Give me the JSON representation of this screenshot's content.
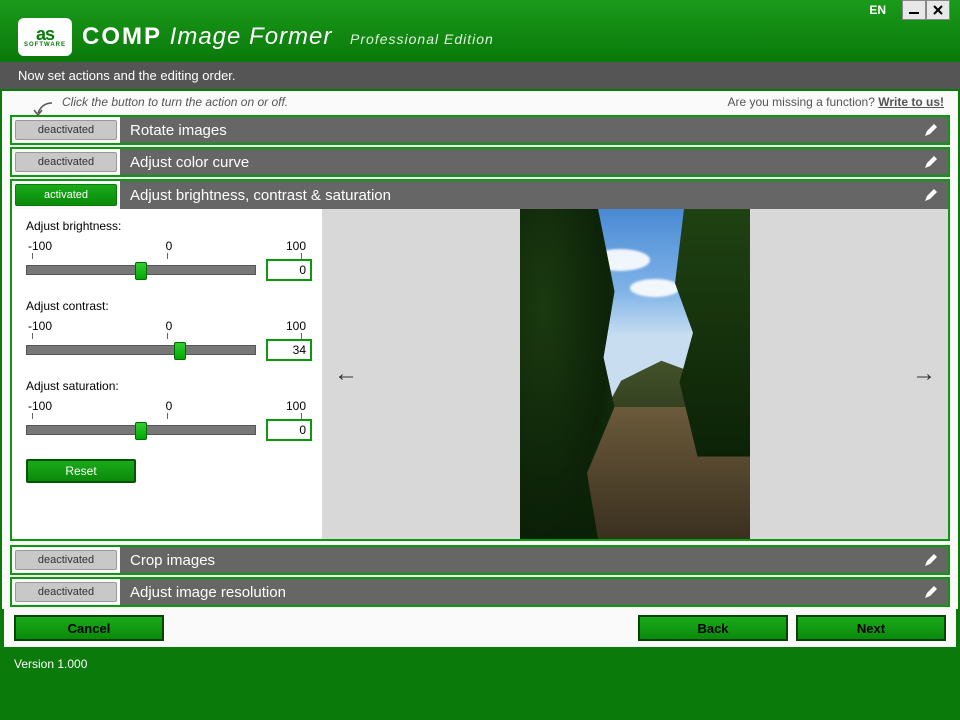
{
  "lang": "EN",
  "brand": {
    "badge_top": "as",
    "badge_bottom": "SOFTWARE",
    "comp": "COMP",
    "product": "Image Former",
    "edition": "Professional Edition"
  },
  "instruction": "Now set actions and the editing order.",
  "hint_left": "Click the button to turn the action on or off.",
  "hint_right_q": "Are you missing a function? ",
  "hint_right_link": "Write to us!",
  "toggle": {
    "off": "deactivated",
    "on": "activated"
  },
  "actions": {
    "rotate": "Rotate images",
    "colorcurve": "Adjust color curve",
    "bcs": "Adjust brightness, contrast & saturation",
    "crop": "Crop images",
    "resolution": "Adjust image resolution"
  },
  "sliders": {
    "brightness": {
      "label": "Adjust brightness:",
      "min": "-100",
      "mid": "0",
      "max": "100",
      "value": "0",
      "pct": 50
    },
    "contrast": {
      "label": "Adjust contrast:",
      "min": "-100",
      "mid": "0",
      "max": "100",
      "value": "34",
      "pct": 67
    },
    "saturation": {
      "label": "Adjust saturation:",
      "min": "-100",
      "mid": "0",
      "max": "100",
      "value": "0",
      "pct": 50
    }
  },
  "reset": "Reset",
  "buttons": {
    "cancel": "Cancel",
    "back": "Back",
    "next": "Next"
  },
  "version": "Version 1.000"
}
